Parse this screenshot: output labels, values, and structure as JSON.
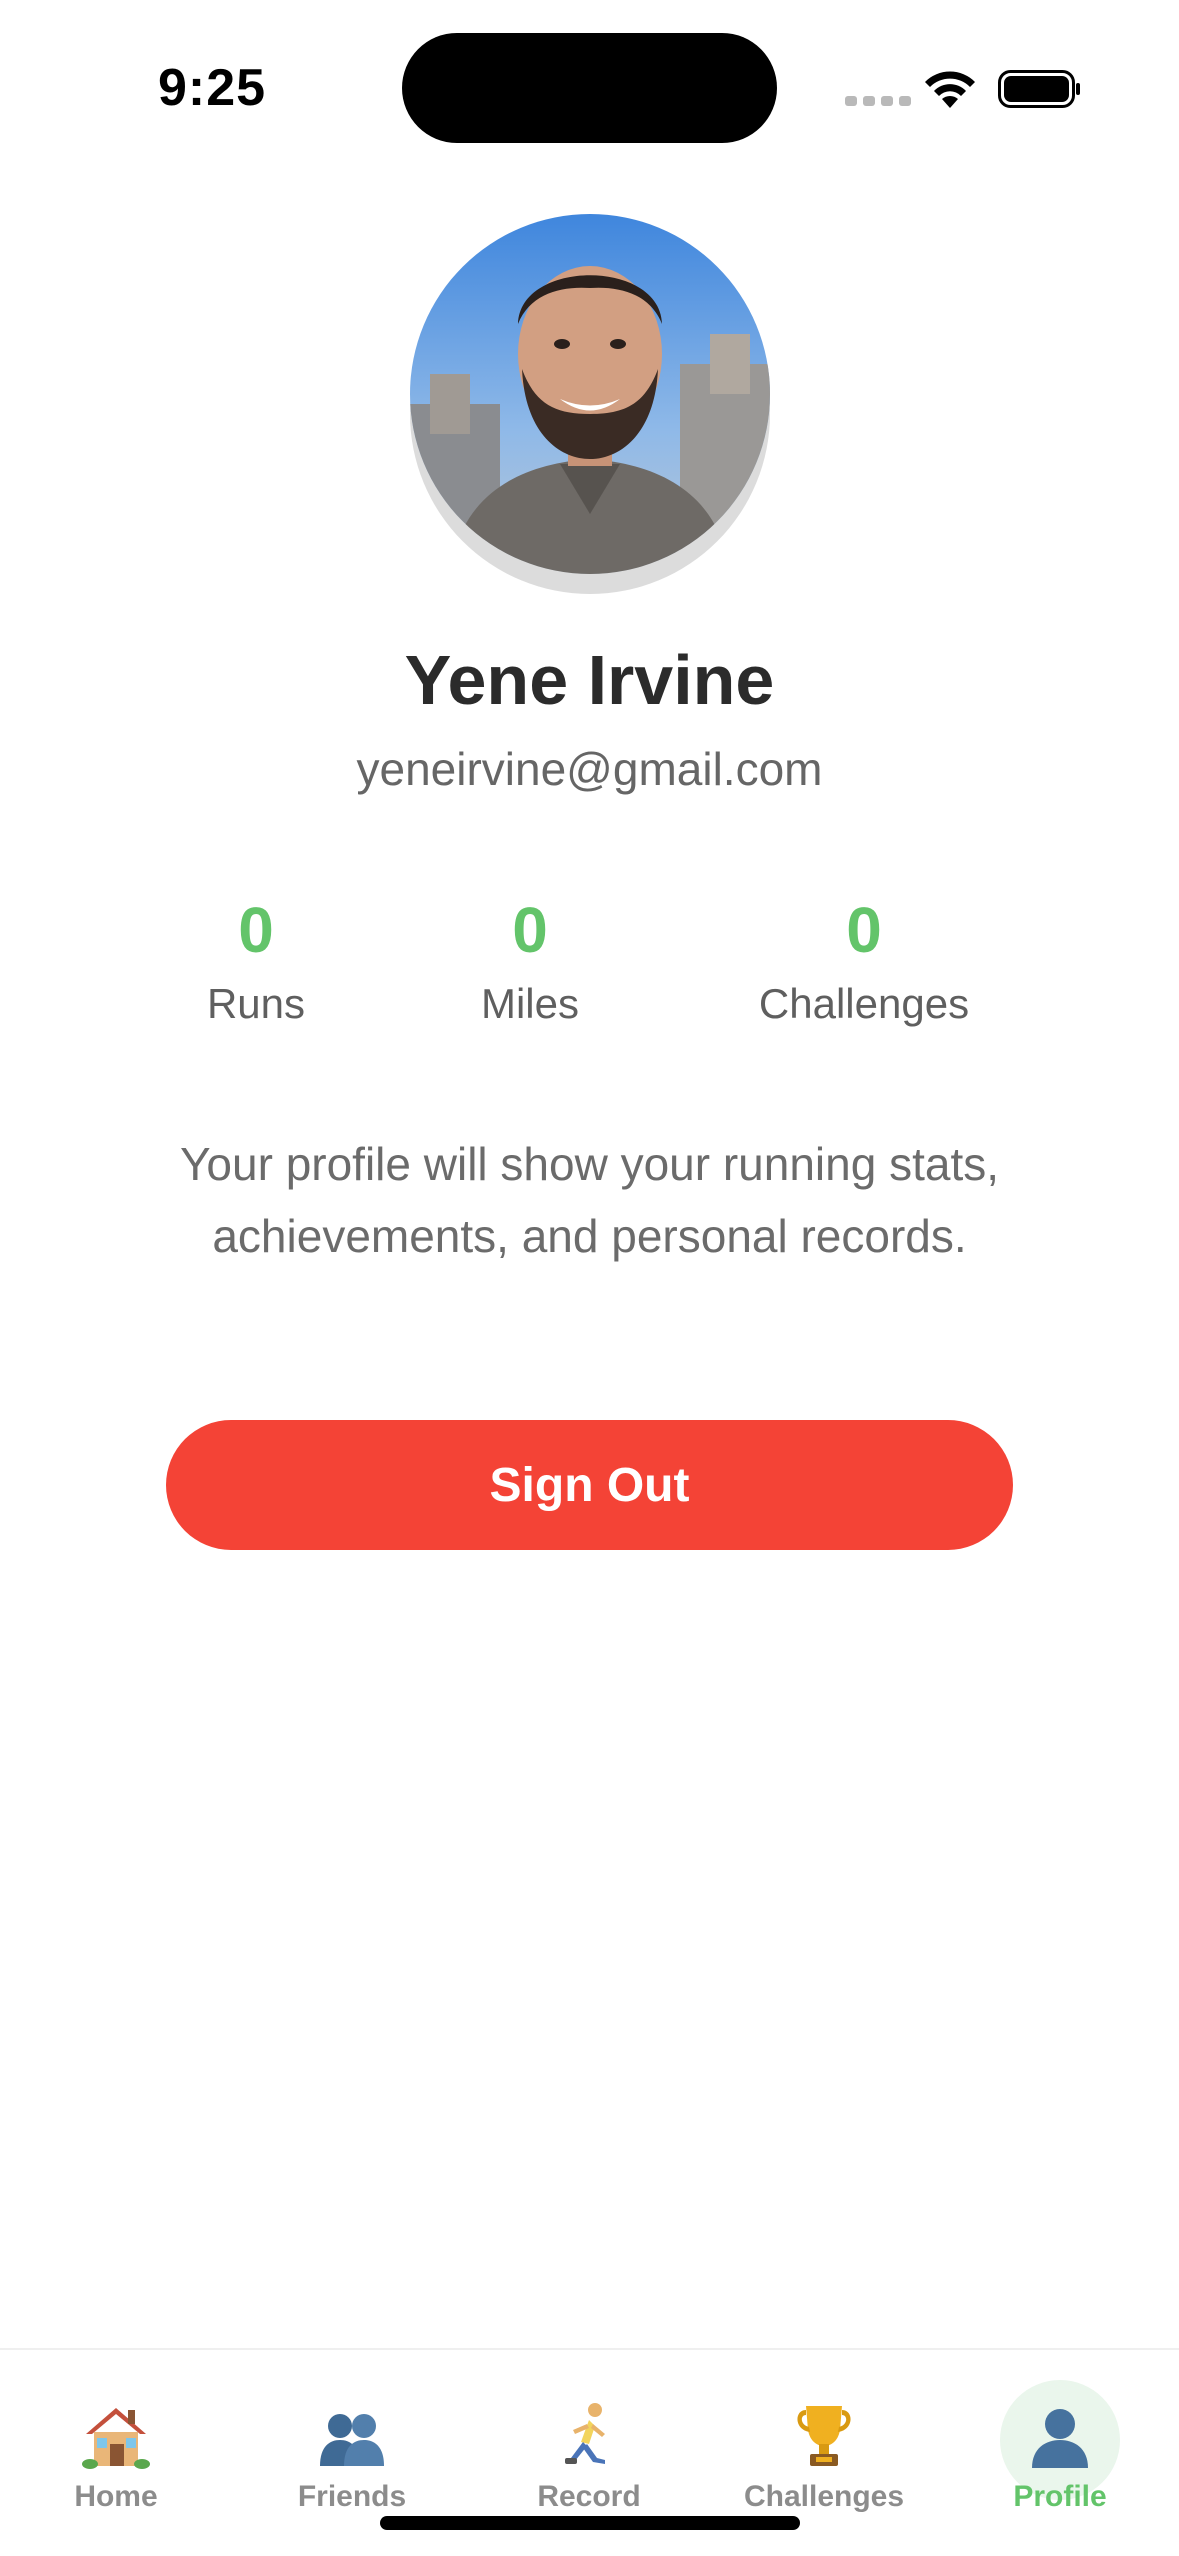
{
  "status_bar": {
    "time": "9:25"
  },
  "profile": {
    "name": "Yene Irvine",
    "email": "yeneirvine@gmail.com",
    "avatar_icon": "avatar-photo"
  },
  "stats": [
    {
      "value": "0",
      "label": "Runs"
    },
    {
      "value": "0",
      "label": "Miles"
    },
    {
      "value": "0",
      "label": "Challenges"
    }
  ],
  "info_text": "Your profile will show your running stats, achievements, and personal records.",
  "sign_out_label": "Sign Out",
  "tab_bar": {
    "active": "Profile",
    "tabs": [
      {
        "label": "Home",
        "icon": "house-icon"
      },
      {
        "label": "Friends",
        "icon": "people-icon"
      },
      {
        "label": "Record",
        "icon": "runner-icon"
      },
      {
        "label": "Challenges",
        "icon": "trophy-icon"
      },
      {
        "label": "Profile",
        "icon": "person-icon"
      }
    ]
  },
  "colors": {
    "accent": "#63c46a",
    "sign_out": "#f44336",
    "name_text": "#2b2b2b",
    "muted_text": "#6b6b6b"
  }
}
